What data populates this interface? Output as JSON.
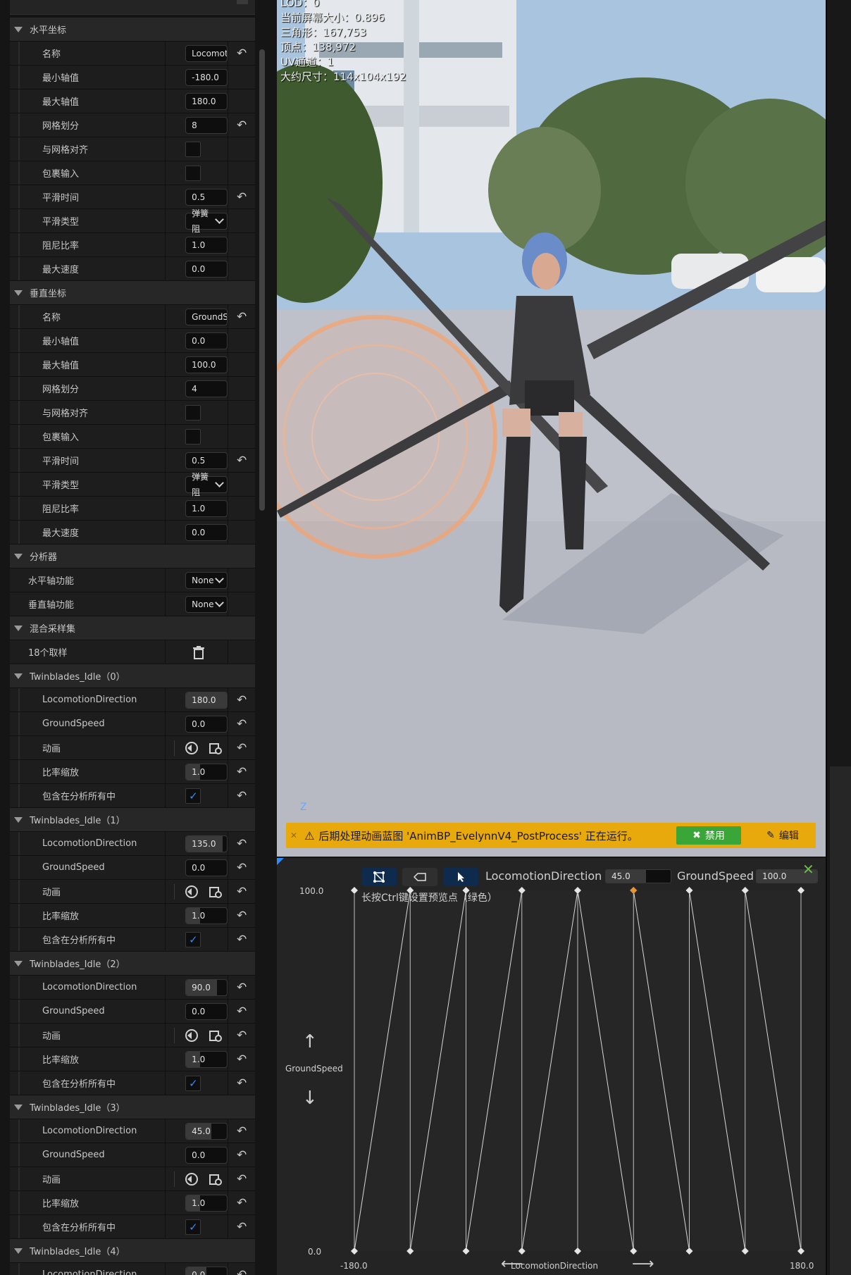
{
  "details": {
    "rows": [
      {
        "type": "section",
        "label": "水平坐标"
      },
      {
        "type": "text",
        "label": "名称",
        "value": "Locomot",
        "reset": true
      },
      {
        "type": "text",
        "label": "最小轴值",
        "value": "-180.0"
      },
      {
        "type": "text",
        "label": "最大轴值",
        "value": "180.0"
      },
      {
        "type": "text",
        "label": "网格划分",
        "value": "8",
        "reset": true
      },
      {
        "type": "check",
        "label": "与网格对齐",
        "checked": false
      },
      {
        "type": "check",
        "label": "包裹输入",
        "checked": false
      },
      {
        "type": "text",
        "label": "平滑时间",
        "value": "0.5",
        "reset": true
      },
      {
        "type": "combo",
        "label": "平滑类型",
        "value": "弹簧阻"
      },
      {
        "type": "text",
        "label": "阻尼比率",
        "value": "1.0"
      },
      {
        "type": "text",
        "label": "最大速度",
        "value": "0.0"
      },
      {
        "type": "section",
        "label": "垂直坐标"
      },
      {
        "type": "text",
        "label": "名称",
        "value": "GroundS",
        "reset": true
      },
      {
        "type": "text",
        "label": "最小轴值",
        "value": "0.0"
      },
      {
        "type": "text",
        "label": "最大轴值",
        "value": "100.0"
      },
      {
        "type": "text",
        "label": "网格划分",
        "value": "4"
      },
      {
        "type": "check",
        "label": "与网格对齐",
        "checked": false
      },
      {
        "type": "check",
        "label": "包裹输入",
        "checked": false
      },
      {
        "type": "text",
        "label": "平滑时间",
        "value": "0.5",
        "reset": true
      },
      {
        "type": "combo",
        "label": "平滑类型",
        "value": "弹簧阻"
      },
      {
        "type": "text",
        "label": "阻尼比率",
        "value": "1.0"
      },
      {
        "type": "text",
        "label": "最大速度",
        "value": "0.0"
      },
      {
        "type": "section",
        "label": "分析器"
      },
      {
        "type": "combo",
        "label": "水平轴功能",
        "value": "None",
        "top": true
      },
      {
        "type": "combo",
        "label": "垂直轴功能",
        "value": "None",
        "top": true
      },
      {
        "type": "section",
        "label": "混合采样集"
      },
      {
        "type": "trash",
        "label": "18个取样",
        "top": true
      },
      {
        "type": "section",
        "label": "Twinblades_Idle（0）"
      },
      {
        "type": "slider",
        "label": "LocomotionDirection",
        "value": "180.0",
        "fill": 1.0,
        "reset": true
      },
      {
        "type": "text",
        "label": "GroundSpeed",
        "value": "0.0",
        "reset": true
      },
      {
        "type": "anim",
        "label": "动画",
        "reset": true
      },
      {
        "type": "slider",
        "label": "比率缩放",
        "value": "1.0",
        "fill": 0.35,
        "reset": true
      },
      {
        "type": "check",
        "label": "包含在分析所有中",
        "checked": true,
        "reset": true
      },
      {
        "type": "section",
        "label": "Twinblades_Idle（1）"
      },
      {
        "type": "slider",
        "label": "LocomotionDirection",
        "value": "135.0",
        "fill": 0.9,
        "reset": true
      },
      {
        "type": "text",
        "label": "GroundSpeed",
        "value": "0.0",
        "reset": true
      },
      {
        "type": "anim",
        "label": "动画",
        "reset": true
      },
      {
        "type": "slider",
        "label": "比率缩放",
        "value": "1.0",
        "fill": 0.35,
        "reset": true
      },
      {
        "type": "check",
        "label": "包含在分析所有中",
        "checked": true,
        "reset": true
      },
      {
        "type": "section",
        "label": "Twinblades_Idle（2）"
      },
      {
        "type": "slider",
        "label": "LocomotionDirection",
        "value": "90.0",
        "fill": 0.75,
        "reset": true
      },
      {
        "type": "text",
        "label": "GroundSpeed",
        "value": "0.0",
        "reset": true
      },
      {
        "type": "anim",
        "label": "动画",
        "reset": true
      },
      {
        "type": "slider",
        "label": "比率缩放",
        "value": "1.0",
        "fill": 0.35,
        "reset": true
      },
      {
        "type": "check",
        "label": "包含在分析所有中",
        "checked": true,
        "reset": true
      },
      {
        "type": "section",
        "label": "Twinblades_Idle（3）"
      },
      {
        "type": "slider",
        "label": "LocomotionDirection",
        "value": "45.0",
        "fill": 0.62,
        "reset": true
      },
      {
        "type": "text",
        "label": "GroundSpeed",
        "value": "0.0",
        "reset": true
      },
      {
        "type": "anim",
        "label": "动画",
        "reset": true
      },
      {
        "type": "slider",
        "label": "比率缩放",
        "value": "1.0",
        "fill": 0.35,
        "reset": true
      },
      {
        "type": "check",
        "label": "包含在分析所有中",
        "checked": true,
        "reset": true
      },
      {
        "type": "section",
        "label": "Twinblades_Idle（4）"
      },
      {
        "type": "slider",
        "label": "LocomotionDirection",
        "value": "0.0",
        "fill": 0.5,
        "reset": true
      }
    ]
  },
  "viewport": {
    "stats": [
      "LOD：0",
      "当前屏幕大小：0.896",
      "三角形：167,753",
      "顶点：138,972",
      "UV通道：1",
      "大约尺寸：114x104x192"
    ],
    "axis_label": "Z",
    "banner": {
      "text": "后期处理动画蓝图 'AnimBP_EvelynnV4_PostProcess' 正在运行。",
      "disable_label": "禁用",
      "edit_label": "编辑"
    }
  },
  "blend": {
    "h_axis_name": "LocomotionDirection",
    "h_axis_value": "45.0",
    "h_axis_fill": 0.62,
    "v_axis_name": "GroundSpeed",
    "v_axis_value": "100.0",
    "v_axis_fill": 1.0,
    "hint": "长按Ctrl键设置预览点（绿色）",
    "y_max": "100.0",
    "y_min": "0.0",
    "x_min": "-180.0",
    "x_max": "180.0",
    "x_axis_label": "LocomotionDirection",
    "y_axis_label": "GroundSpeed",
    "x_range": [
      -180,
      180
    ],
    "y_range": [
      0,
      100
    ],
    "divisions": 8,
    "top_samples_x": [
      -180,
      -135,
      -90,
      -45,
      0,
      45,
      90,
      135,
      180
    ],
    "bottom_samples_x": [
      -180,
      -135,
      -90,
      -45,
      0,
      45,
      90,
      135,
      180
    ],
    "preview_x": 45,
    "accent_color": "#e8a90d",
    "preview_color": "#f0922a"
  }
}
